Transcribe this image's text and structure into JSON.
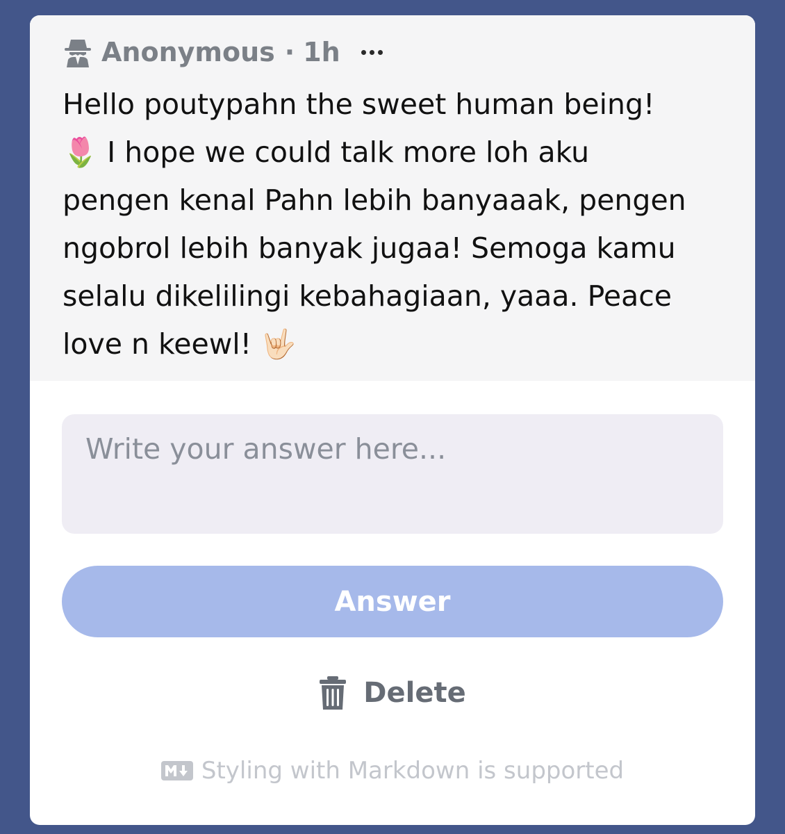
{
  "question": {
    "author": "Anonymous",
    "separator": "·",
    "time": "1h",
    "icons": {
      "author": "spy-icon",
      "menu": "more-icon"
    },
    "message": "Hello poutypahn the sweet human being!\n🌷 I hope we could talk more loh aku\npengen kenal Pahn lebih banyaaak, pengen\nngobrol lebih banyak jugaa! Semoga kamu\nselalu dikelilingi kebahagiaan, yaaa. Peace\nlove n keewl! 🤟🏻"
  },
  "answer": {
    "value": "",
    "placeholder": "Write your answer here...",
    "button_label": "Answer",
    "button_color": "#a6b9ea"
  },
  "delete": {
    "label": "Delete",
    "icon": "trash-icon"
  },
  "footer": {
    "markdown_note": "Styling with Markdown is supported",
    "icon": "markdown-icon"
  },
  "colors": {
    "background": "#43568a",
    "card": "#ffffff",
    "question_bg": "#f5f5f6",
    "input_bg": "#efedf4"
  }
}
